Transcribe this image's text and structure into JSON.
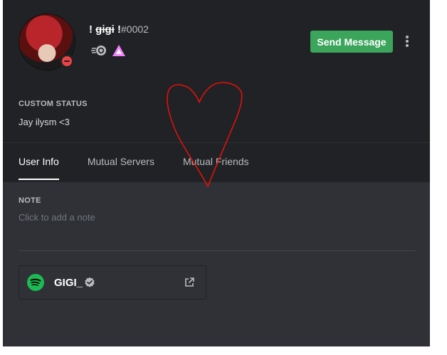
{
  "profile": {
    "username_prefix": "! ",
    "username_strike": "gigi",
    "username_suffix": " !",
    "discriminator": "#0002",
    "status": "dnd",
    "avatar_icon": "anime-avatar"
  },
  "badges": [
    {
      "icon": "nitro-icon"
    },
    {
      "icon": "hypesquad-icon"
    }
  ],
  "actions": {
    "send_message_label": "Send Message",
    "more_icon": "kebab-icon"
  },
  "custom_status": {
    "label": "CUSTOM STATUS",
    "text": "Jay ilysm <3"
  },
  "tabs": [
    {
      "label": "User Info",
      "active": true
    },
    {
      "label": "Mutual Servers",
      "active": false
    },
    {
      "label": "Mutual Friends",
      "active": false
    }
  ],
  "note": {
    "label": "NOTE",
    "placeholder": "Click to add a note"
  },
  "connections": [
    {
      "service": "spotify",
      "name": "GIGI_",
      "verified": true
    }
  ],
  "colors": {
    "accent_green": "#3ba55c",
    "dnd_red": "#ed4245",
    "spotify_green": "#1db954",
    "heart_red": "#e3100b",
    "hypesquad_pink": "#f47fff"
  }
}
